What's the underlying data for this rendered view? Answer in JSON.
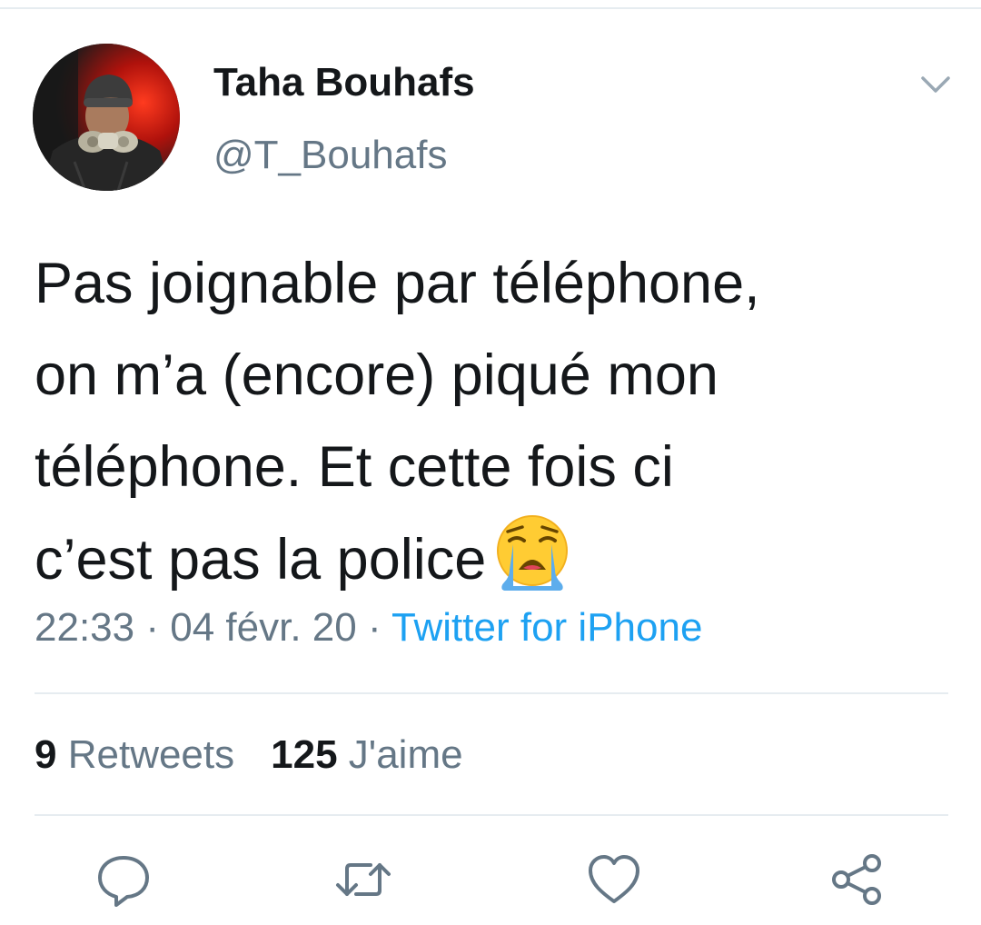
{
  "tweet": {
    "author": {
      "display_name": "Taha Bouhafs",
      "handle": "@T_Bouhafs"
    },
    "text_lines": [
      "Pas joignable par téléphone,",
      "on m’a (encore) piqué mon",
      "téléphone. Et cette fois ci",
      "c’est pas la police"
    ],
    "emoji": "loudly-crying-face",
    "time": "22:33",
    "date": "04 févr. 20",
    "separator": "·",
    "source": "Twitter for iPhone"
  },
  "stats": {
    "retweets_count": "9",
    "retweets_label": "Retweets",
    "likes_count": "125",
    "likes_label": "J'aime"
  },
  "actions": [
    "reply-icon",
    "retweet-icon",
    "like-icon",
    "share-icon"
  ],
  "colors": {
    "text": "#14171a",
    "secondary": "#657786",
    "link": "#1da1f2",
    "divider": "#e6ecf0"
  }
}
